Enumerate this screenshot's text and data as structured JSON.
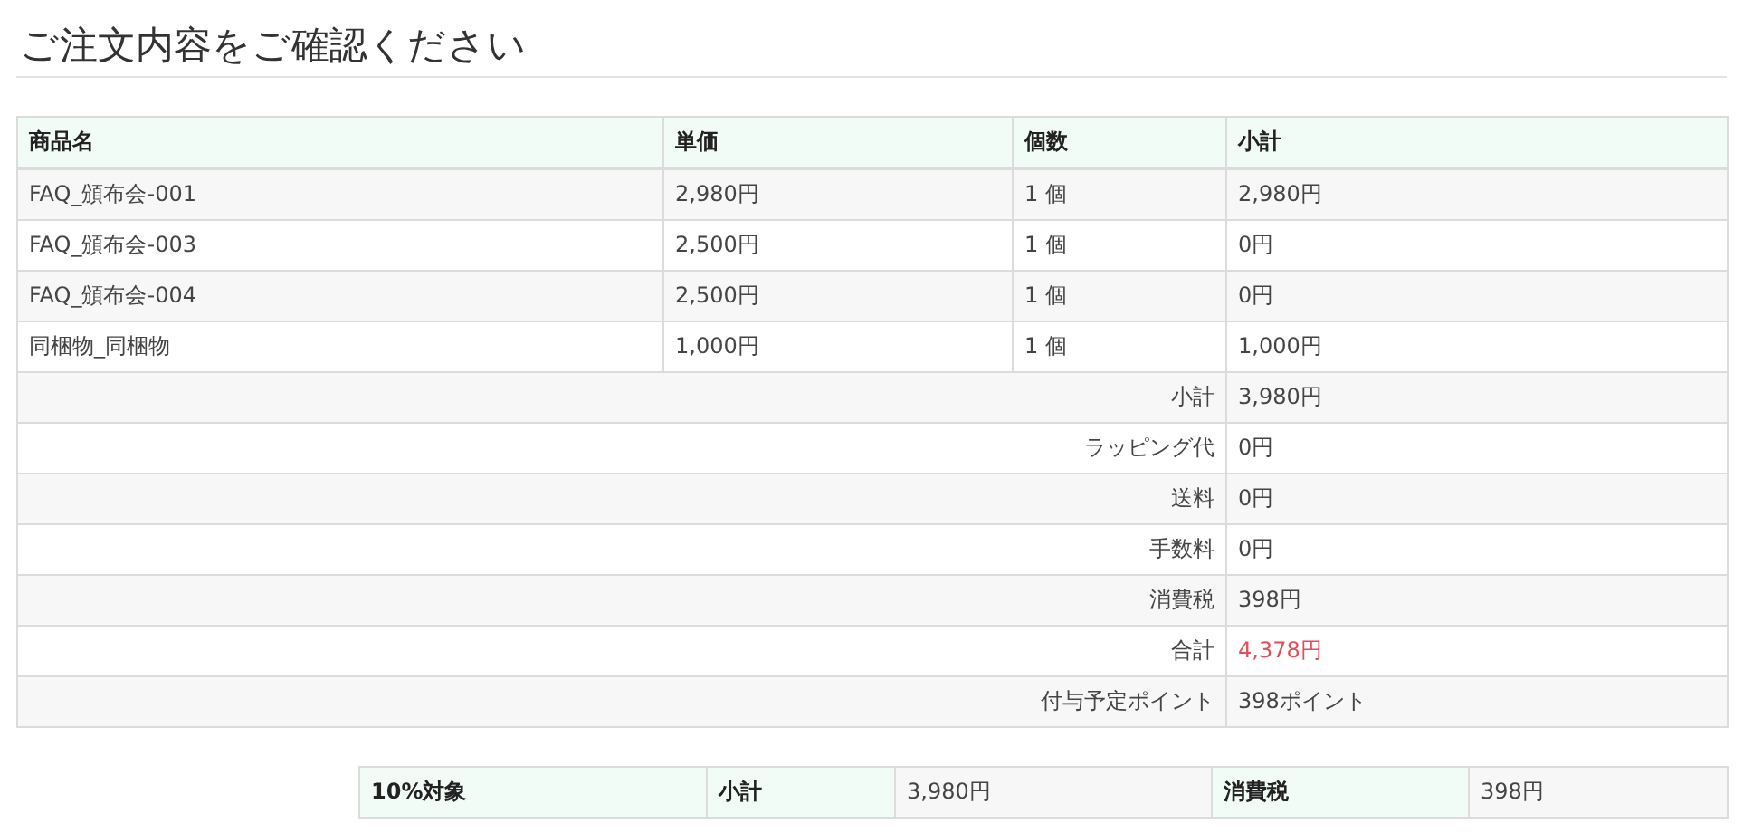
{
  "title": "ご注文内容をご確認ください",
  "order_table": {
    "columns": [
      "商品名",
      "単価",
      "個数",
      "小計"
    ],
    "rows": [
      [
        "FAQ_頒布会-001",
        "2,980円",
        "1 個",
        "2,980円"
      ],
      [
        "FAQ_頒布会-003",
        "2,500円",
        "1 個",
        "0円"
      ],
      [
        "FAQ_頒布会-004",
        "2,500円",
        "1 個",
        "0円"
      ],
      [
        "同梱物_同梱物",
        "1,000円",
        "1 個",
        "1,000円"
      ]
    ],
    "summary": [
      {
        "label": "小計",
        "value": "3,980円",
        "emphasis": false
      },
      {
        "label": "ラッピング代",
        "value": "0円",
        "emphasis": false
      },
      {
        "label": "送料",
        "value": "0円",
        "emphasis": false
      },
      {
        "label": "手数料",
        "value": "0円",
        "emphasis": false
      },
      {
        "label": "消費税",
        "value": "398円",
        "emphasis": false
      },
      {
        "label": "合計",
        "value": "4,378円",
        "emphasis": true
      },
      {
        "label": "付与予定ポイント",
        "value": "398ポイント",
        "emphasis": false
      }
    ]
  },
  "tax_table": [
    {
      "kind": "header",
      "text": "10%対象"
    },
    {
      "kind": "header",
      "text": "小計"
    },
    {
      "kind": "value",
      "text": "3,980円"
    },
    {
      "kind": "header",
      "text": "消費税"
    },
    {
      "kind": "value",
      "text": "398円"
    }
  ]
}
